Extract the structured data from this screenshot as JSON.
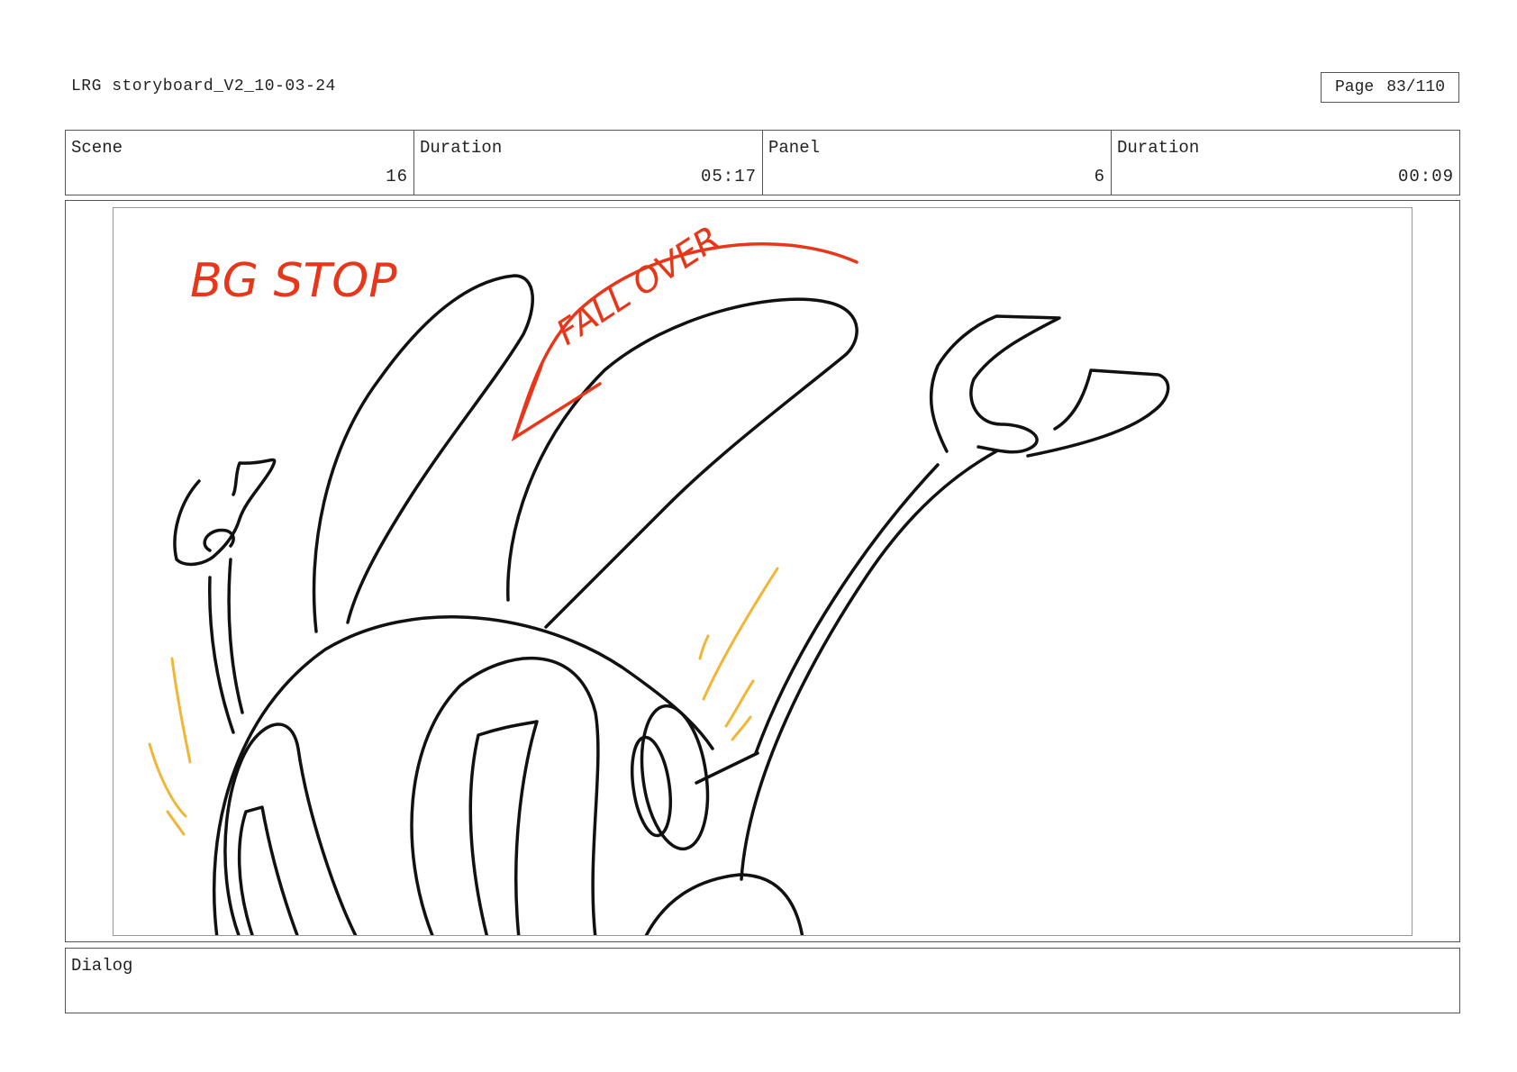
{
  "header": {
    "document_title": "LRG storyboard_V2_10-03-24",
    "page_label": "Page",
    "page_value": "83/110"
  },
  "info": {
    "scene_label": "Scene",
    "scene_value": "16",
    "scene_duration_label": "Duration",
    "scene_duration_value": "05:17",
    "panel_label": "Panel",
    "panel_value": "6",
    "panel_duration_label": "Duration",
    "panel_duration_value": "00:09"
  },
  "panel": {
    "annotations": {
      "bg_stop": "BG STOP",
      "fall_over": "FALL OVER"
    },
    "colors": {
      "line": "#111111",
      "annotation": "#e8361a",
      "motion": "#f2b535"
    }
  },
  "dialog": {
    "label": "Dialog"
  }
}
